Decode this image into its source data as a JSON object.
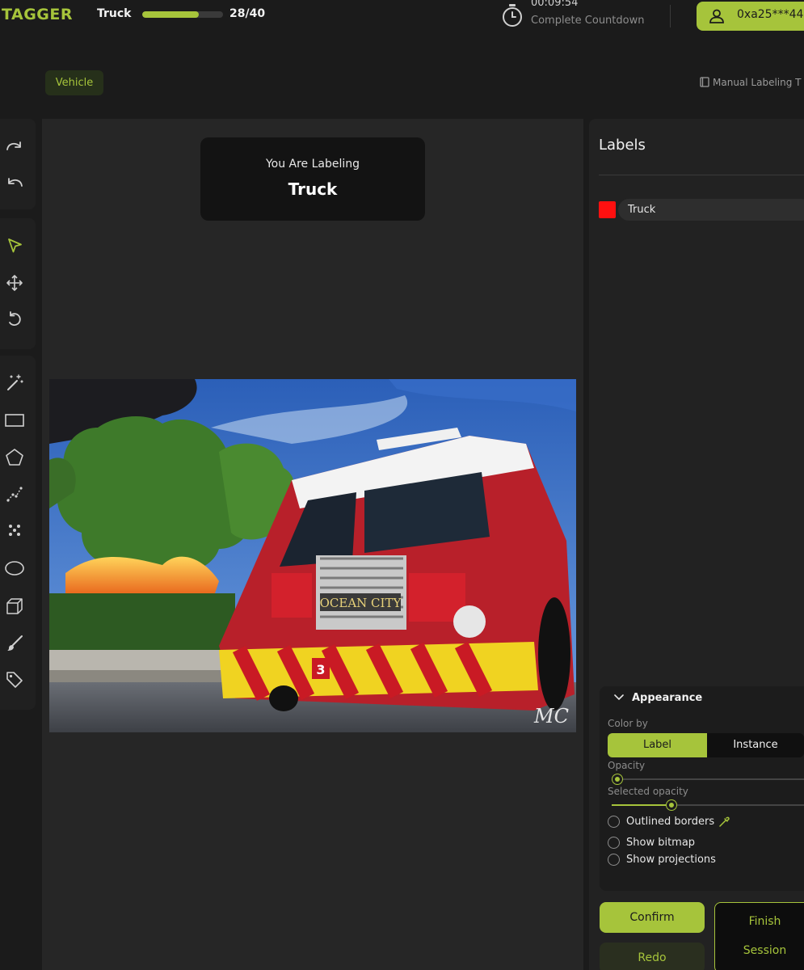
{
  "header": {
    "logo": "TAGGER",
    "task_name": "Truck",
    "progress": {
      "current": 28,
      "total": 40,
      "text": "28/40"
    },
    "timer": {
      "value": "00:09:54",
      "label": "Complete Countdown"
    },
    "user_address": "0xa25***44"
  },
  "subheader": {
    "category": "Vehicle",
    "manual_link": "Manual Labeling T"
  },
  "toolbar": {
    "groups": [
      [
        "redo-icon",
        "undo-icon"
      ],
      [
        "select-icon",
        "move-icon",
        "reset-icon"
      ],
      [
        "magic-wand-icon",
        "rectangle-icon",
        "polygon-icon",
        "polyline-icon",
        "points-icon",
        "ellipse-icon",
        "cuboid-icon",
        "brush-icon",
        "tag-icon"
      ]
    ]
  },
  "canvas": {
    "caption": "You Are Labeling",
    "target": "Truck",
    "photo": "fire truck in front of a burning building",
    "photo_text": {
      "grille": "OCEAN CITY",
      "bumper": "3",
      "watermark": "MC"
    }
  },
  "labels_panel": {
    "title": "Labels",
    "items": [
      {
        "name": "Truck",
        "color": "#ff1010"
      }
    ]
  },
  "appearance": {
    "title": "Appearance",
    "color_by_label": "Color by",
    "color_by_options": [
      "Label",
      "Instance"
    ],
    "color_by_selected": "Label",
    "opacity_label": "Opacity",
    "opacity_value": 0.03,
    "selected_opacity_label": "Selected opacity",
    "selected_opacity_value": 0.3,
    "checkboxes": [
      {
        "label": "Outlined borders",
        "checked": false
      },
      {
        "label": "Show bitmap",
        "checked": false
      },
      {
        "label": "Show projections",
        "checked": false
      }
    ]
  },
  "actions": {
    "confirm": "Confirm",
    "redo": "Redo",
    "finish_line1": "Finish",
    "finish_line2": "Session"
  },
  "colors": {
    "accent": "#a6c43b",
    "background": "#1b1b1b",
    "label_truck": "#ff1010"
  }
}
